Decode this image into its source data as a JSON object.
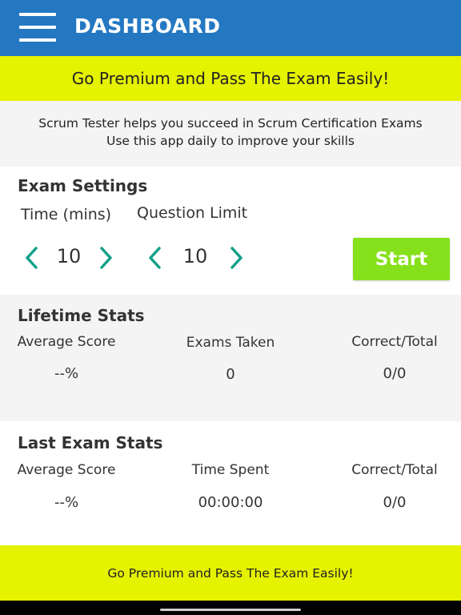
{
  "app_bar": {
    "title": "DASHBOARD",
    "menu_icon": "hamburger-menu-icon",
    "color": "#2478c2"
  },
  "promo": {
    "top_text": "Go Premium and Pass The Exam Easily!",
    "bottom_text": "Go Premium and Pass The Exam Easily!",
    "color": "#e5f200"
  },
  "intro": {
    "line1": "Scrum Tester helps you succeed in Scrum Certification Exams",
    "line2": "Use this app daily to improve your skills"
  },
  "exam_settings": {
    "title": "Exam Settings",
    "time_label": "Time (mins)",
    "question_label": "Question Limit",
    "time_value": "10",
    "question_value": "10",
    "decrement_icon": "chevron-left-icon",
    "increment_icon": "chevron-right-icon",
    "start_label": "Start",
    "start_color": "#86e01b",
    "chevron_color": "#13a08a"
  },
  "lifetime_stats": {
    "title": "Lifetime Stats",
    "headers": [
      "Average Score",
      "Exams Taken",
      "Correct/Total"
    ],
    "values": [
      "--%",
      "0",
      "0/0"
    ]
  },
  "last_exam_stats": {
    "title": "Last Exam Stats",
    "headers": [
      "Average Score",
      "Time Spent",
      "Correct/Total"
    ],
    "values": [
      "--%",
      "00:00:00",
      "0/0"
    ]
  }
}
